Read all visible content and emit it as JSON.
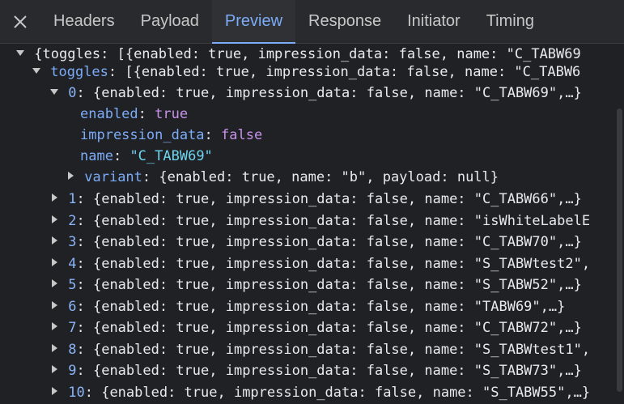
{
  "tabs": {
    "headers": "Headers",
    "payload": "Payload",
    "preview": "Preview",
    "response": "Response",
    "initiator": "Initiator",
    "timing": "Timing"
  },
  "tree": {
    "root_text": "{toggles: [{enabled: true, impression_data: false, name: \"C_TABW69",
    "toggles_key": "toggles",
    "toggles_preview": ": [{enabled: true, impression_data: false, name: \"C_TABW6",
    "item0": {
      "index": "0",
      "preview": ": {enabled: true, impression_data: false, name: \"C_TABW69\",…}",
      "enabled_key": "enabled",
      "enabled_val": "true",
      "impression_key": "impression_data",
      "impression_val": "false",
      "name_key": "name",
      "name_val": "\"C_TABW69\"",
      "variant_key": "variant",
      "variant_preview": ": {enabled: true, name: \"b\", payload: null}"
    },
    "items": [
      {
        "index": "1",
        "preview": ": {enabled: true, impression_data: false, name: \"C_TABW66\",…}"
      },
      {
        "index": "2",
        "preview": ": {enabled: true, impression_data: false, name: \"isWhiteLabelE"
      },
      {
        "index": "3",
        "preview": ": {enabled: true, impression_data: false, name: \"C_TABW70\",…}"
      },
      {
        "index": "4",
        "preview": ": {enabled: true, impression_data: false, name: \"S_TABWtest2\","
      },
      {
        "index": "5",
        "preview": ": {enabled: true, impression_data: false, name: \"S_TABW52\",…}"
      },
      {
        "index": "6",
        "preview": ": {enabled: true, impression_data: false, name: \"TABW69\",…}"
      },
      {
        "index": "7",
        "preview": ": {enabled: true, impression_data: false, name: \"C_TABW72\",…}"
      },
      {
        "index": "8",
        "preview": ": {enabled: true, impression_data: false, name: \"S_TABWtest1\","
      },
      {
        "index": "9",
        "preview": ": {enabled: true, impression_data: false, name: \"S_TABW73\",…}"
      },
      {
        "index": "10",
        "preview": ": {enabled: true, impression_data: false, name: \"S_TABW55\",…}"
      }
    ]
  },
  "icons": {
    "close": "close-icon",
    "expanded": "triangle-down-icon",
    "collapsed": "triangle-right-icon"
  },
  "colors": {
    "accent": "#7cacf8",
    "string": "#6dd3f0",
    "boolean": "#c792ea",
    "background": "#202124"
  }
}
